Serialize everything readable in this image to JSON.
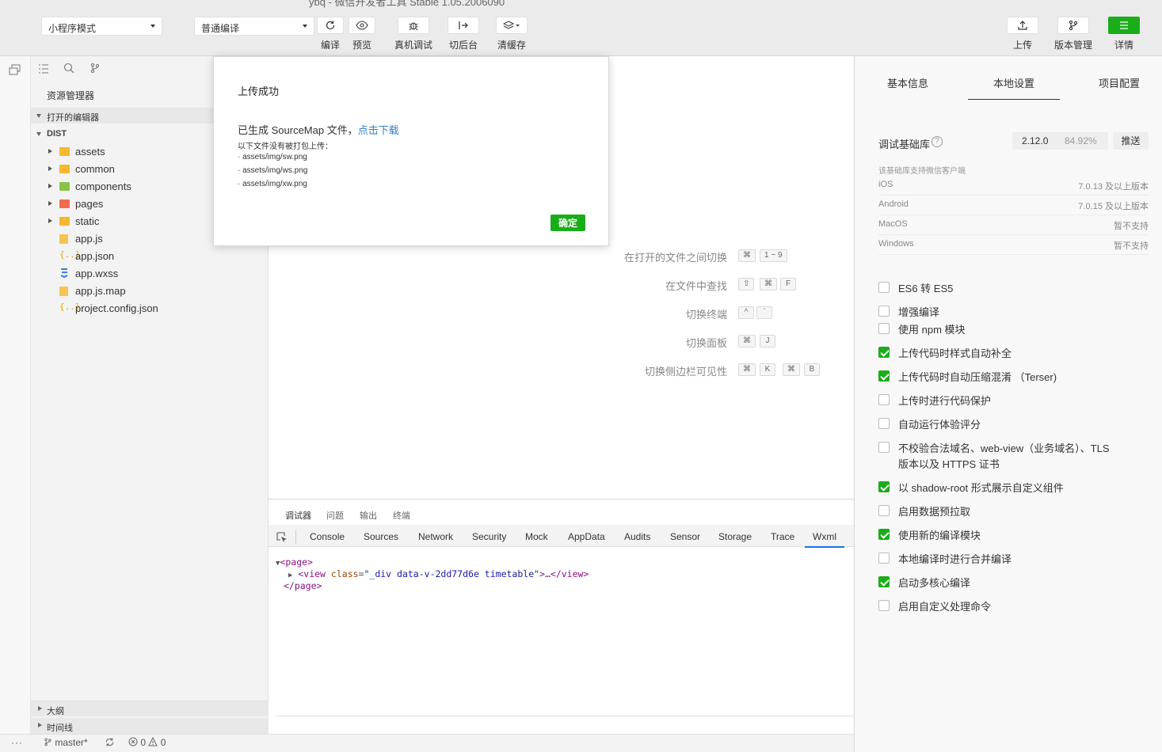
{
  "titlebar": {
    "text": "ybq - 微信开发者工具 Stable 1.05.2006090"
  },
  "toolbar": {
    "mode_select": "小程序模式",
    "compile_select": "普通编译",
    "compile_label": "编译",
    "preview_label": "预览",
    "remote_debug_label": "真机调试",
    "background_label": "切后台",
    "clear_cache_label": "清缓存",
    "upload_label": "上传",
    "version_label": "版本管理",
    "details_label": "详情"
  },
  "explorer": {
    "title": "资源管理器",
    "open_editors": "打开的编辑器",
    "root": "DIST",
    "items": [
      {
        "name": "assets",
        "type": "folder"
      },
      {
        "name": "common",
        "type": "folder"
      },
      {
        "name": "components",
        "type": "folder"
      },
      {
        "name": "pages",
        "type": "folder"
      },
      {
        "name": "static",
        "type": "folder"
      },
      {
        "name": "app.js",
        "type": "js"
      },
      {
        "name": "app.json",
        "type": "json"
      },
      {
        "name": "app.wxss",
        "type": "wxss"
      },
      {
        "name": "app.js.map",
        "type": "map"
      },
      {
        "name": "project.config.json",
        "type": "json"
      }
    ],
    "outline": "大纲",
    "timeline": "时间线"
  },
  "statusbar": {
    "more": "···",
    "branch": "master*",
    "errors": "0",
    "warnings": "0"
  },
  "shortcuts": [
    {
      "label": "在打开的文件之间切换",
      "keys": [
        "⌘",
        "1 ~ 9"
      ]
    },
    {
      "label": "在文件中查找",
      "keys": [
        "⇧",
        "⌘",
        "F"
      ]
    },
    {
      "label": "切换终端",
      "keys": [
        "^",
        "`"
      ]
    },
    {
      "label": "切换面板",
      "keys": [
        "⌘",
        "J"
      ]
    },
    {
      "label": "切换侧边栏可见性",
      "keys": [
        "⌘",
        "K",
        "⌘",
        "B"
      ]
    }
  ],
  "modal": {
    "title": "上传成功",
    "message": "已生成 SourceMap 文件，",
    "link": "点击下载",
    "note": "以下文件没有被打包上传：",
    "files": [
      "· assets/img/sw.png",
      "· assets/img/ws.png",
      "· assets/img/xw.png"
    ],
    "ok": "确定"
  },
  "debugger": {
    "tabs": [
      "调试器",
      "问题",
      "输出",
      "终端"
    ],
    "devtools_tabs": [
      "Console",
      "Sources",
      "Network",
      "Security",
      "Mock",
      "AppData",
      "Audits",
      "Sensor",
      "Storage",
      "Trace",
      "Wxml"
    ],
    "code": {
      "l1": "<page>",
      "l2_tag_open": "<view",
      "l2_attr": "class",
      "l2_value": "\"_div data-v-2dd77d6e timetable\"",
      "l2_rest": ">…</view>",
      "l3": "</page>"
    }
  },
  "settings": {
    "tabs": [
      "基本信息",
      "本地设置",
      "项目配置"
    ],
    "lib_label": "调试基础库",
    "lib_version": "2.12.0",
    "lib_percent": "84.92%",
    "push_label": "推送",
    "support_note": "该基础库支持微信客户端",
    "support": [
      {
        "platform": "iOS",
        "value": "7.0.13 及以上版本"
      },
      {
        "platform": "Android",
        "value": "7.0.15 及以上版本"
      },
      {
        "platform": "MacOS",
        "value": "暂不支持"
      },
      {
        "platform": "Windows",
        "value": "暂不支持"
      }
    ],
    "options": [
      {
        "label": "ES6 转 ES5",
        "checked": false
      },
      {
        "label": "增强编译",
        "checked": false
      },
      {
        "label": "使用 npm 模块",
        "checked": false
      },
      {
        "label": "上传代码时样式自动补全",
        "checked": true
      },
      {
        "label": "上传代码时自动压缩混淆 （Terser)",
        "checked": true
      },
      {
        "label": "上传时进行代码保护",
        "checked": false
      },
      {
        "label": "自动运行体验评分",
        "checked": false
      },
      {
        "label": "不校验合法域名、web-view（业务域名）、TLS",
        "label2": "版本以及 HTTPS 证书",
        "checked": false
      },
      {
        "label": "以 shadow-root 形式展示自定义组件",
        "checked": true
      },
      {
        "label": "启用数据预拉取",
        "checked": false
      },
      {
        "label": "使用新的编译模块",
        "checked": true
      },
      {
        "label": "本地编译时进行合并编译",
        "checked": false
      },
      {
        "label": "启动多核心编译",
        "checked": true
      },
      {
        "label": "启用自定义处理命令",
        "checked": false
      }
    ]
  }
}
